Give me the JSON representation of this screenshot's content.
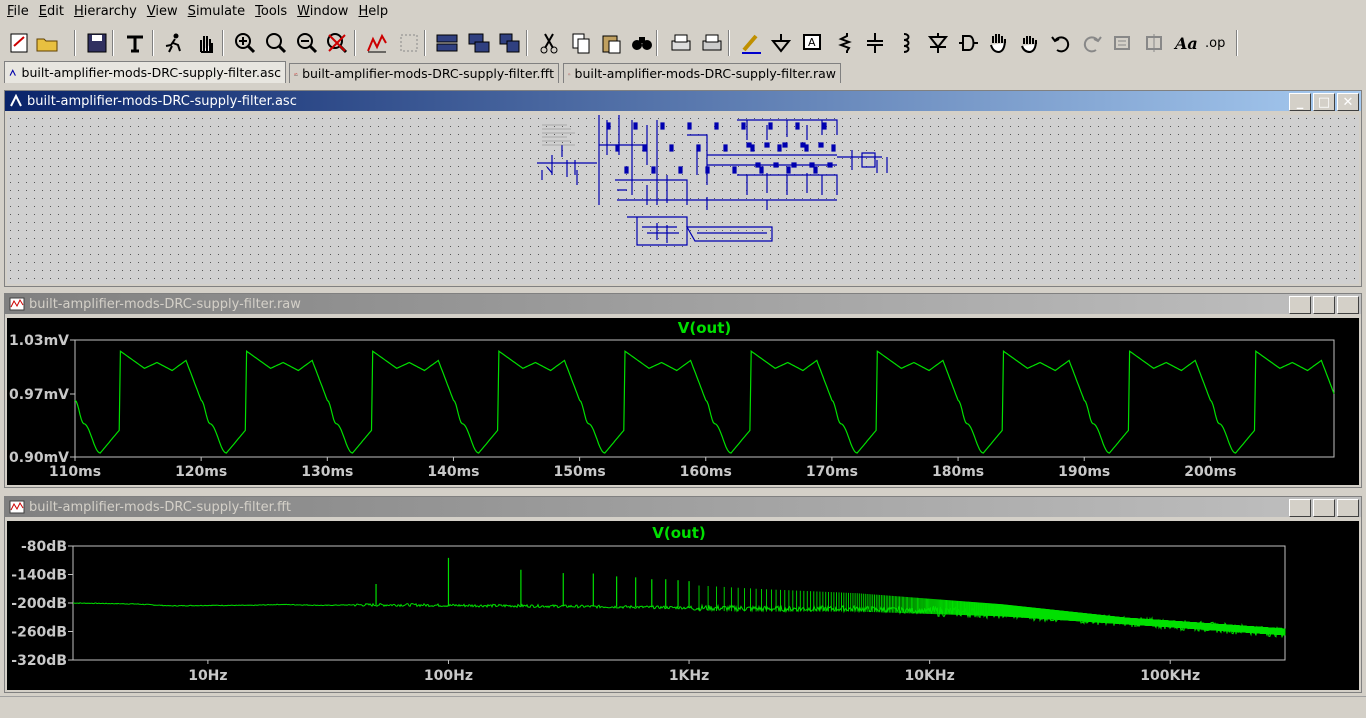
{
  "menu": [
    "File",
    "Edit",
    "Hierarchy",
    "View",
    "Simulate",
    "Tools",
    "Window",
    "Help"
  ],
  "tabs": [
    {
      "label": "built-amplifier-mods-DRC-supply-filter.asc",
      "icon": "schematic-icon",
      "active": true
    },
    {
      "label": "built-amplifier-mods-DRC-supply-filter.fft",
      "icon": "waveform-icon",
      "active": false
    },
    {
      "label": "built-amplifier-mods-DRC-supply-filter.raw",
      "icon": "waveform-icon",
      "active": false
    }
  ],
  "windows": {
    "schematic": {
      "title": "built-amplifier-mods-DRC-supply-filter.asc",
      "colors": {
        "title_start": "#0a246a",
        "title_end": "#a6caf0",
        "wire": "#0000b0",
        "dots": "#555555",
        "background": "#d0d0d0"
      }
    },
    "transient": {
      "title": "built-amplifier-mods-DRC-supply-filter.raw"
    },
    "fft": {
      "title": "built-amplifier-mods-DRC-supply-filter.fft"
    }
  },
  "window_buttons": {
    "minimize": "_",
    "restore": "□",
    "close": "✕"
  },
  "chart_data": [
    {
      "type": "line",
      "title": "V(out)",
      "x_tick_labels": [
        "110ms",
        "120ms",
        "130ms",
        "140ms",
        "150ms",
        "160ms",
        "170ms",
        "180ms",
        "190ms",
        "200ms"
      ],
      "x_ticks_ms": [
        110,
        120,
        130,
        140,
        150,
        160,
        170,
        180,
        190,
        200
      ],
      "y_tick_labels": [
        "1.03mV",
        "0.97mV",
        "0.90mV"
      ],
      "y_ticks_mV": [
        1.03,
        0.97,
        0.9
      ],
      "xlim_ms": [
        110,
        209.8
      ],
      "ylim_mV": [
        0.9,
        1.03
      ],
      "ripple_period_ms": 10,
      "waveform_period": {
        "x_offset_ms": [
          0,
          2,
          3,
          4.2,
          5.3,
          6.5,
          7.2,
          8.5,
          10
        ],
        "v_mV": [
          1.0185,
          0.9985,
          1.005,
          0.9961,
          1.0073,
          0.963,
          0.937,
          0.9044,
          0.9296
        ]
      },
      "series": [
        {
          "name": "V(out)",
          "color": "#00e000"
        }
      ],
      "grid": false
    },
    {
      "type": "line",
      "title": "V(out)",
      "x_tick_labels": [
        "10Hz",
        "100Hz",
        "1KHz",
        "10KHz",
        "100KHz"
      ],
      "x_ticks_hz": [
        10,
        100,
        1000,
        10000,
        100000
      ],
      "x_scale": "log",
      "xlim_hz": [
        2.75,
        300000
      ],
      "y_tick_labels": [
        "-80dB",
        "-140dB",
        "-200dB",
        "-260dB",
        "-320dB"
      ],
      "y_ticks_db": [
        -80,
        -140,
        -200,
        -260,
        -320
      ],
      "ylim_db": [
        -320,
        -80
      ],
      "baseline_db": {
        "hz": [
          2.75,
          5,
          7,
          10,
          15,
          20,
          30,
          40,
          50,
          70,
          100,
          200,
          500,
          1000,
          2000,
          5000,
          10000,
          20000,
          50000,
          100000,
          300000
        ],
        "db": [
          -200,
          -202,
          -206,
          -205,
          -205,
          -203,
          -205,
          -204,
          -204,
          -204,
          -205,
          -206,
          -208,
          -210,
          -212,
          -212,
          -217,
          -222,
          -235,
          -245,
          -262
        ]
      },
      "peaks": {
        "hz": [
          50,
          100,
          200,
          300,
          400,
          500,
          600,
          700,
          800,
          900,
          1000
        ],
        "db": [
          -160,
          -105,
          -130,
          -137,
          -138,
          -144,
          -146,
          -150,
          -150,
          -152,
          -154
        ]
      },
      "series": [
        {
          "name": "V(out)",
          "color": "#00e000"
        }
      ],
      "grid": false
    }
  ]
}
